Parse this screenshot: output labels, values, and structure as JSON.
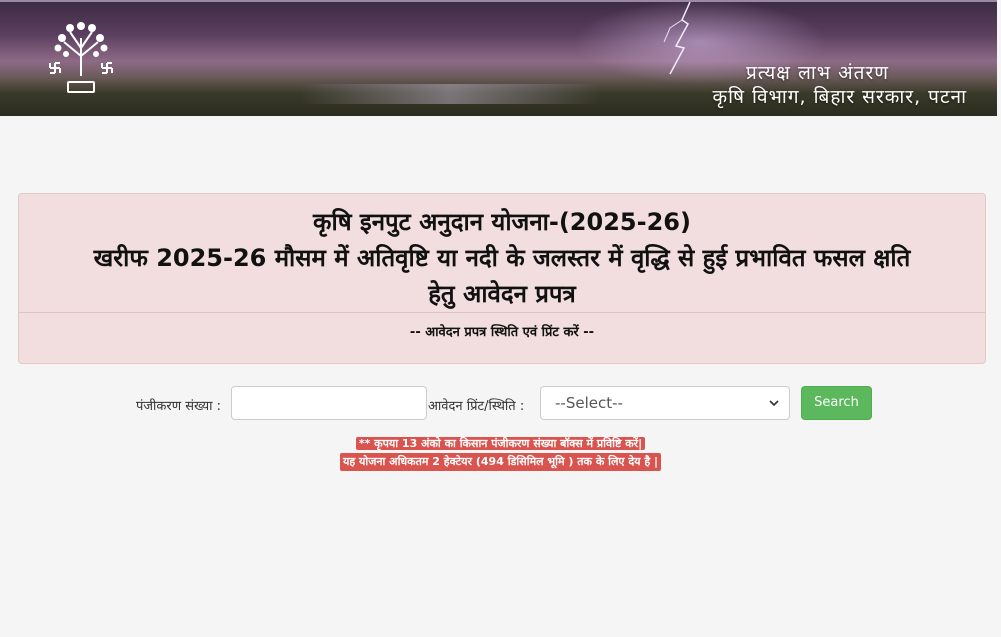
{
  "banner": {
    "line1": "प्रत्यक्ष लाभ अंतरण",
    "line2": "कृषि विभाग, बिहार सरकार, पटना"
  },
  "panel": {
    "title_line1": "कृषि इनपुट अनुदान योजना-(2025-26)",
    "title_line2": "खरीफ 2025-26 मौसम में अतिवृष्टि या नदी के जलस्तर में वृद्धि से हुई प्रभावित फसल क्षति",
    "title_line3": "हेतु आवेदन प्रपत्र",
    "subtitle": "-- आवेदन प्रपत्र स्थिति एवं प्रिंट करें --"
  },
  "form": {
    "registration_label": "पंजीकरण संख्या :",
    "registration_value": "",
    "status_label": "आवेदन प्रिंट/स्थिति :",
    "status_selected": "--Select--",
    "search_label": "Search"
  },
  "notice": {
    "line1": "** कृपया 13 अंको का किसान पंजीकरण संख्या बॉक्स में प्रविष्टि करें|",
    "line2": "यह योजना अधिकतम 2 हेक्टेयर (494 डिसिमिल भूमि ) तक के लिए देय है |"
  },
  "colors": {
    "panel_bg": "#f2dede",
    "search_button": "#5cb85c",
    "notice_bg": "#d9534f"
  }
}
